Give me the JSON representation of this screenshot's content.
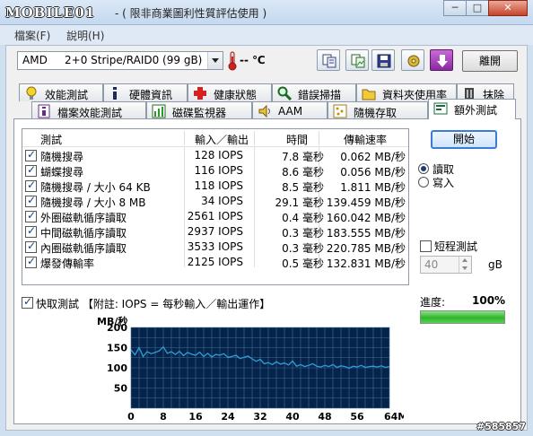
{
  "window": {
    "logo": "MOBILE01",
    "title": "- ( 限非商業圖利性質評估使用 )",
    "controls": {
      "minimize": "─",
      "maximize": "□",
      "close": "✕"
    }
  },
  "menu": {
    "file": "檔案(F)",
    "help": "說明(H)"
  },
  "toolbar": {
    "drive": {
      "model": "AMD",
      "desc": "2+0 Stripe/RAID0 (99 gB)"
    },
    "temperature": "-- ℃",
    "exit_label": "離開",
    "icons": [
      "copy-text-icon",
      "copy-image-icon",
      "save-icon",
      "options-icon",
      "download-icon"
    ]
  },
  "tabs_top": [
    {
      "label": "效能測試",
      "icon": "bulb-icon"
    },
    {
      "label": "硬體資訊",
      "icon": "info-icon"
    },
    {
      "label": "健康狀態",
      "icon": "health-cross-icon"
    },
    {
      "label": "錯誤掃描",
      "icon": "magnifier-icon"
    },
    {
      "label": "資料夾使用率",
      "icon": "folder-icon"
    },
    {
      "label": "抹除",
      "icon": "erase-icon"
    }
  ],
  "tabs_bottom": [
    {
      "label": "檔案效能測試",
      "icon": "file-bench-icon"
    },
    {
      "label": "磁碟監視器",
      "icon": "monitor-chart-icon"
    },
    {
      "label": "AAM",
      "icon": "speaker-icon"
    },
    {
      "label": "隨機存取",
      "icon": "random-access-icon"
    },
    {
      "label": "額外測試",
      "icon": "extra-tests-icon",
      "active": true
    }
  ],
  "results": {
    "headers": {
      "test": "測試",
      "io": "輸入／輸出",
      "time": "時間",
      "rate": "傳輸速率"
    },
    "rows": [
      {
        "name": "隨機搜尋",
        "iops": "128 IOPS",
        "time": "7.8 毫秒",
        "rate": "0.062 MB/秒"
      },
      {
        "name": "蝴蝶搜尋",
        "iops": "116 IOPS",
        "time": "8.6 毫秒",
        "rate": "0.056 MB/秒"
      },
      {
        "name": "隨機搜尋 / 大小 64 KB",
        "iops": "118 IOPS",
        "time": "8.5 毫秒",
        "rate": "1.811 MB/秒"
      },
      {
        "name": "隨機搜尋 / 大小 8 MB",
        "iops": "34 IOPS",
        "time": "29.1 毫秒",
        "rate": "139.459 MB/秒"
      },
      {
        "name": "外圈磁軌循序讀取",
        "iops": "2561 IOPS",
        "time": "0.4 毫秒",
        "rate": "160.042 MB/秒"
      },
      {
        "name": "中間磁軌循序讀取",
        "iops": "2937 IOPS",
        "time": "0.3 毫秒",
        "rate": "183.555 MB/秒"
      },
      {
        "name": "內圈磁軌循序讀取",
        "iops": "3533 IOPS",
        "time": "0.3 毫秒",
        "rate": "220.785 MB/秒"
      },
      {
        "name": "爆發傳輸率",
        "iops": "2125 IOPS",
        "time": "0.5 毫秒",
        "rate": "132.831 MB/秒"
      }
    ]
  },
  "side": {
    "start_label": "開始",
    "read_label": "讀取",
    "write_label": "寫入",
    "short_test_label": "短程測試",
    "size_value": "40",
    "size_unit": "gB",
    "progress_label": "進度:",
    "progress_text": "100%",
    "progress_value": 1.0
  },
  "quick_test_label": "快取測試 【附註: IOPS = 每秒輸入／輸出運作】",
  "watermark": "#585857",
  "chart_data": {
    "type": "line",
    "ylabel": "MB/秒",
    "xlabel_unit": "MB",
    "ylim": [
      0,
      200
    ],
    "y_ticks": [
      50,
      100,
      150,
      200
    ],
    "xlim": [
      0,
      64
    ],
    "x_ticks": [
      0,
      8,
      16,
      24,
      32,
      40,
      48,
      56,
      64
    ],
    "x_tick_labels": [
      "0",
      "8",
      "16",
      "24",
      "32",
      "40",
      "48",
      "56",
      "64MB"
    ],
    "grid": true,
    "series": [
      {
        "color": "#2e9fd6",
        "x": [
          0,
          1,
          2,
          3,
          4,
          5,
          6,
          7,
          8,
          9,
          10,
          11,
          12,
          13,
          14,
          15,
          16,
          17,
          18,
          19,
          20,
          21,
          22,
          23,
          24,
          25,
          26,
          27,
          28,
          29,
          30,
          31,
          32,
          33,
          34,
          35,
          36,
          37,
          38,
          39,
          40,
          41,
          42,
          43,
          44,
          45,
          46,
          47,
          48,
          49,
          50,
          51,
          52,
          53,
          54,
          55,
          56,
          57,
          58,
          59,
          60,
          61,
          62,
          63,
          64
        ],
        "y": [
          145,
          132,
          150,
          128,
          140,
          135,
          138,
          142,
          152,
          136,
          140,
          133,
          141,
          130,
          138,
          134,
          131,
          139,
          128,
          136,
          127,
          133,
          131,
          135,
          126,
          128,
          131,
          123,
          126,
          129,
          122,
          116,
          121,
          110,
          113,
          108,
          115,
          109,
          112,
          107,
          117,
          104,
          108,
          103,
          106,
          110,
          104,
          102,
          106,
          103,
          108,
          101,
          105,
          103,
          99,
          104,
          102,
          106,
          101,
          103,
          104,
          102,
          105,
          101,
          103
        ]
      }
    ]
  }
}
